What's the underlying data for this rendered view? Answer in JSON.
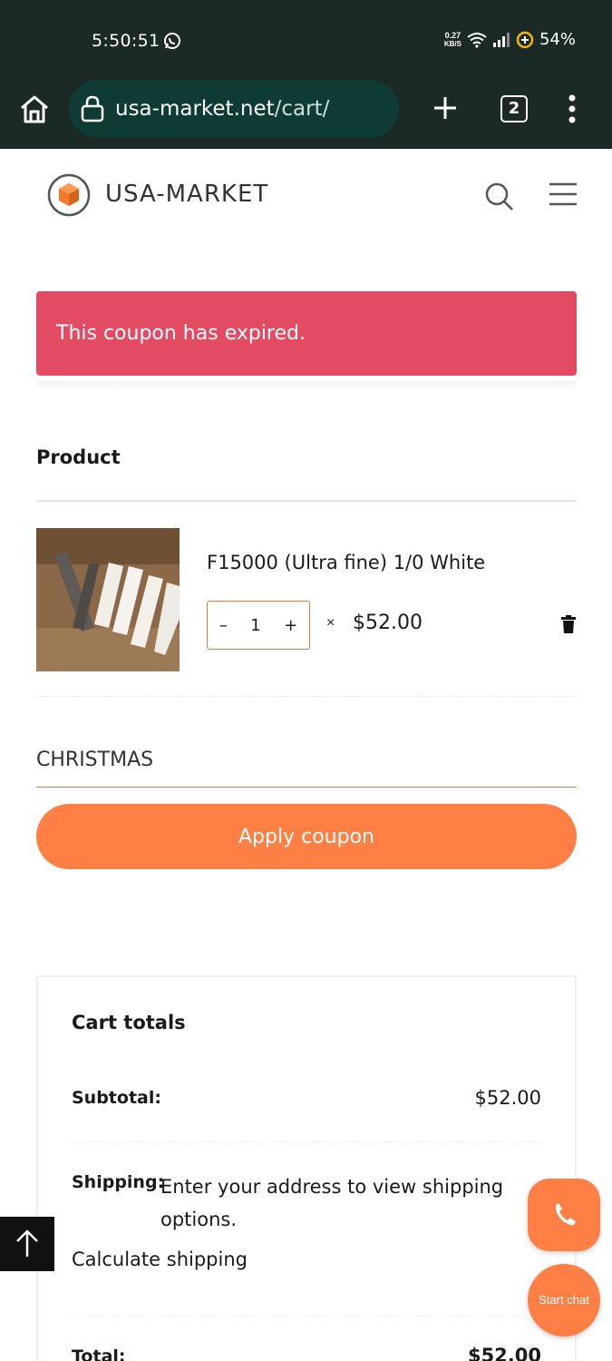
{
  "status_bar": {
    "time": "5:50:51",
    "net_speed_top": "0.27",
    "net_speed_bottom": "KB/S",
    "battery": "54%"
  },
  "browser": {
    "url_host": "usa-market.net",
    "url_path": "/cart/",
    "tab_count": "2"
  },
  "site": {
    "brand": "USA-MARKET"
  },
  "notice": {
    "message": "This coupon has expired."
  },
  "cart": {
    "column_header": "Product",
    "items": [
      {
        "name": "F15000 (Ultra fine) 1/0 White",
        "quantity": "1",
        "qty_minus": "–",
        "qty_plus": "+",
        "times": "×",
        "price": "$52.00"
      }
    ]
  },
  "coupon": {
    "value": "CHRISTMAS",
    "apply_label": "Apply coupon"
  },
  "totals": {
    "title": "Cart totals",
    "subtotal_label": "Subtotal:",
    "subtotal_value": "$52.00",
    "shipping_label": "Shipping:",
    "shipping_text": "Enter your address to view shipping options.",
    "calc_shipping": "Calculate shipping",
    "total_label": "Total:",
    "total_value": "$52.00"
  },
  "floating": {
    "chat_label": "Start chat"
  },
  "colors": {
    "accent": "#ff7f45",
    "notice": "#e34b62",
    "chrome_bg": "#1b2a27",
    "urlbar_bg": "#0f3b35"
  }
}
